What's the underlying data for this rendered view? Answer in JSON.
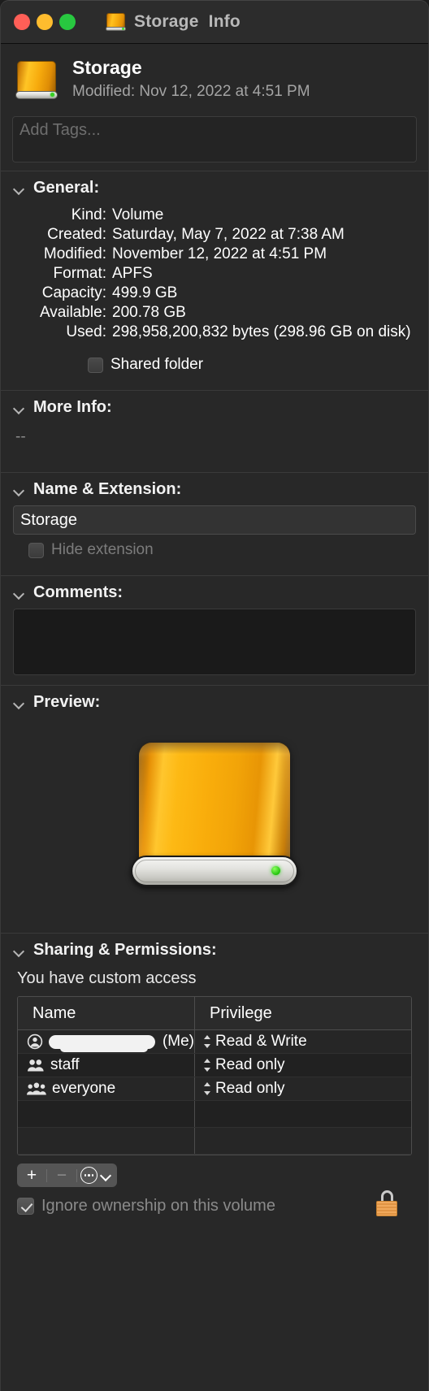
{
  "window": {
    "title": "Storage  Info",
    "title_icon": "hard-drive-icon",
    "traffic_lights": {
      "close_color": "#ff5f57",
      "minimize_color": "#febc2e",
      "zoom_color": "#28c840"
    }
  },
  "header": {
    "icon": "hard-drive-icon",
    "name": "Storage",
    "modified": "Modified: Nov 12, 2022 at 4:51 PM"
  },
  "tags": {
    "placeholder": "Add Tags...",
    "value": ""
  },
  "sections": {
    "general": {
      "title": "General:",
      "rows": [
        {
          "label": "Kind:",
          "value": "Volume"
        },
        {
          "label": "Created:",
          "value": "Saturday, May 7, 2022 at 7:38 AM"
        },
        {
          "label": "Modified:",
          "value": "November 12, 2022 at 4:51 PM"
        },
        {
          "label": "Format:",
          "value": "APFS"
        },
        {
          "label": "Capacity:",
          "value": "499.9 GB"
        },
        {
          "label": "Available:",
          "value": "200.78 GB"
        },
        {
          "label": "Used:",
          "value": "298,958,200,832 bytes (298.96 GB on disk)"
        }
      ],
      "shared_folder": {
        "label": "Shared folder",
        "checked": false
      }
    },
    "more_info": {
      "title": "More Info:",
      "body": "--"
    },
    "name_extension": {
      "title": "Name & Extension:",
      "name_value": "Storage",
      "hide_extension": {
        "label": "Hide extension",
        "checked": false,
        "enabled": false
      }
    },
    "comments": {
      "title": "Comments:",
      "value": ""
    },
    "preview": {
      "title": "Preview:",
      "icon": "hard-drive-icon"
    },
    "sharing": {
      "title": "Sharing & Permissions:",
      "access_text": "You have custom access",
      "columns": [
        "Name",
        "Privilege"
      ],
      "rows": [
        {
          "icon": "user-icon",
          "name": "",
          "redacted": true,
          "suffix": "(Me)",
          "privilege": "Read & Write"
        },
        {
          "icon": "group-icon",
          "name": "staff",
          "redacted": false,
          "suffix": "",
          "privilege": "Read only"
        },
        {
          "icon": "everyone-icon",
          "name": "everyone",
          "redacted": false,
          "suffix": "",
          "privilege": "Read only"
        }
      ],
      "empty_rows": 2,
      "toolbar": {
        "add_label": "+",
        "remove_label": "−",
        "action_icon": "gear-icon",
        "chevron_icon": "chevron-down-icon"
      },
      "ignore_ownership": {
        "label": "Ignore ownership on this volume",
        "checked": true,
        "enabled": false
      },
      "lock": {
        "icon": "lock-closed-icon",
        "state": "locked"
      }
    }
  }
}
